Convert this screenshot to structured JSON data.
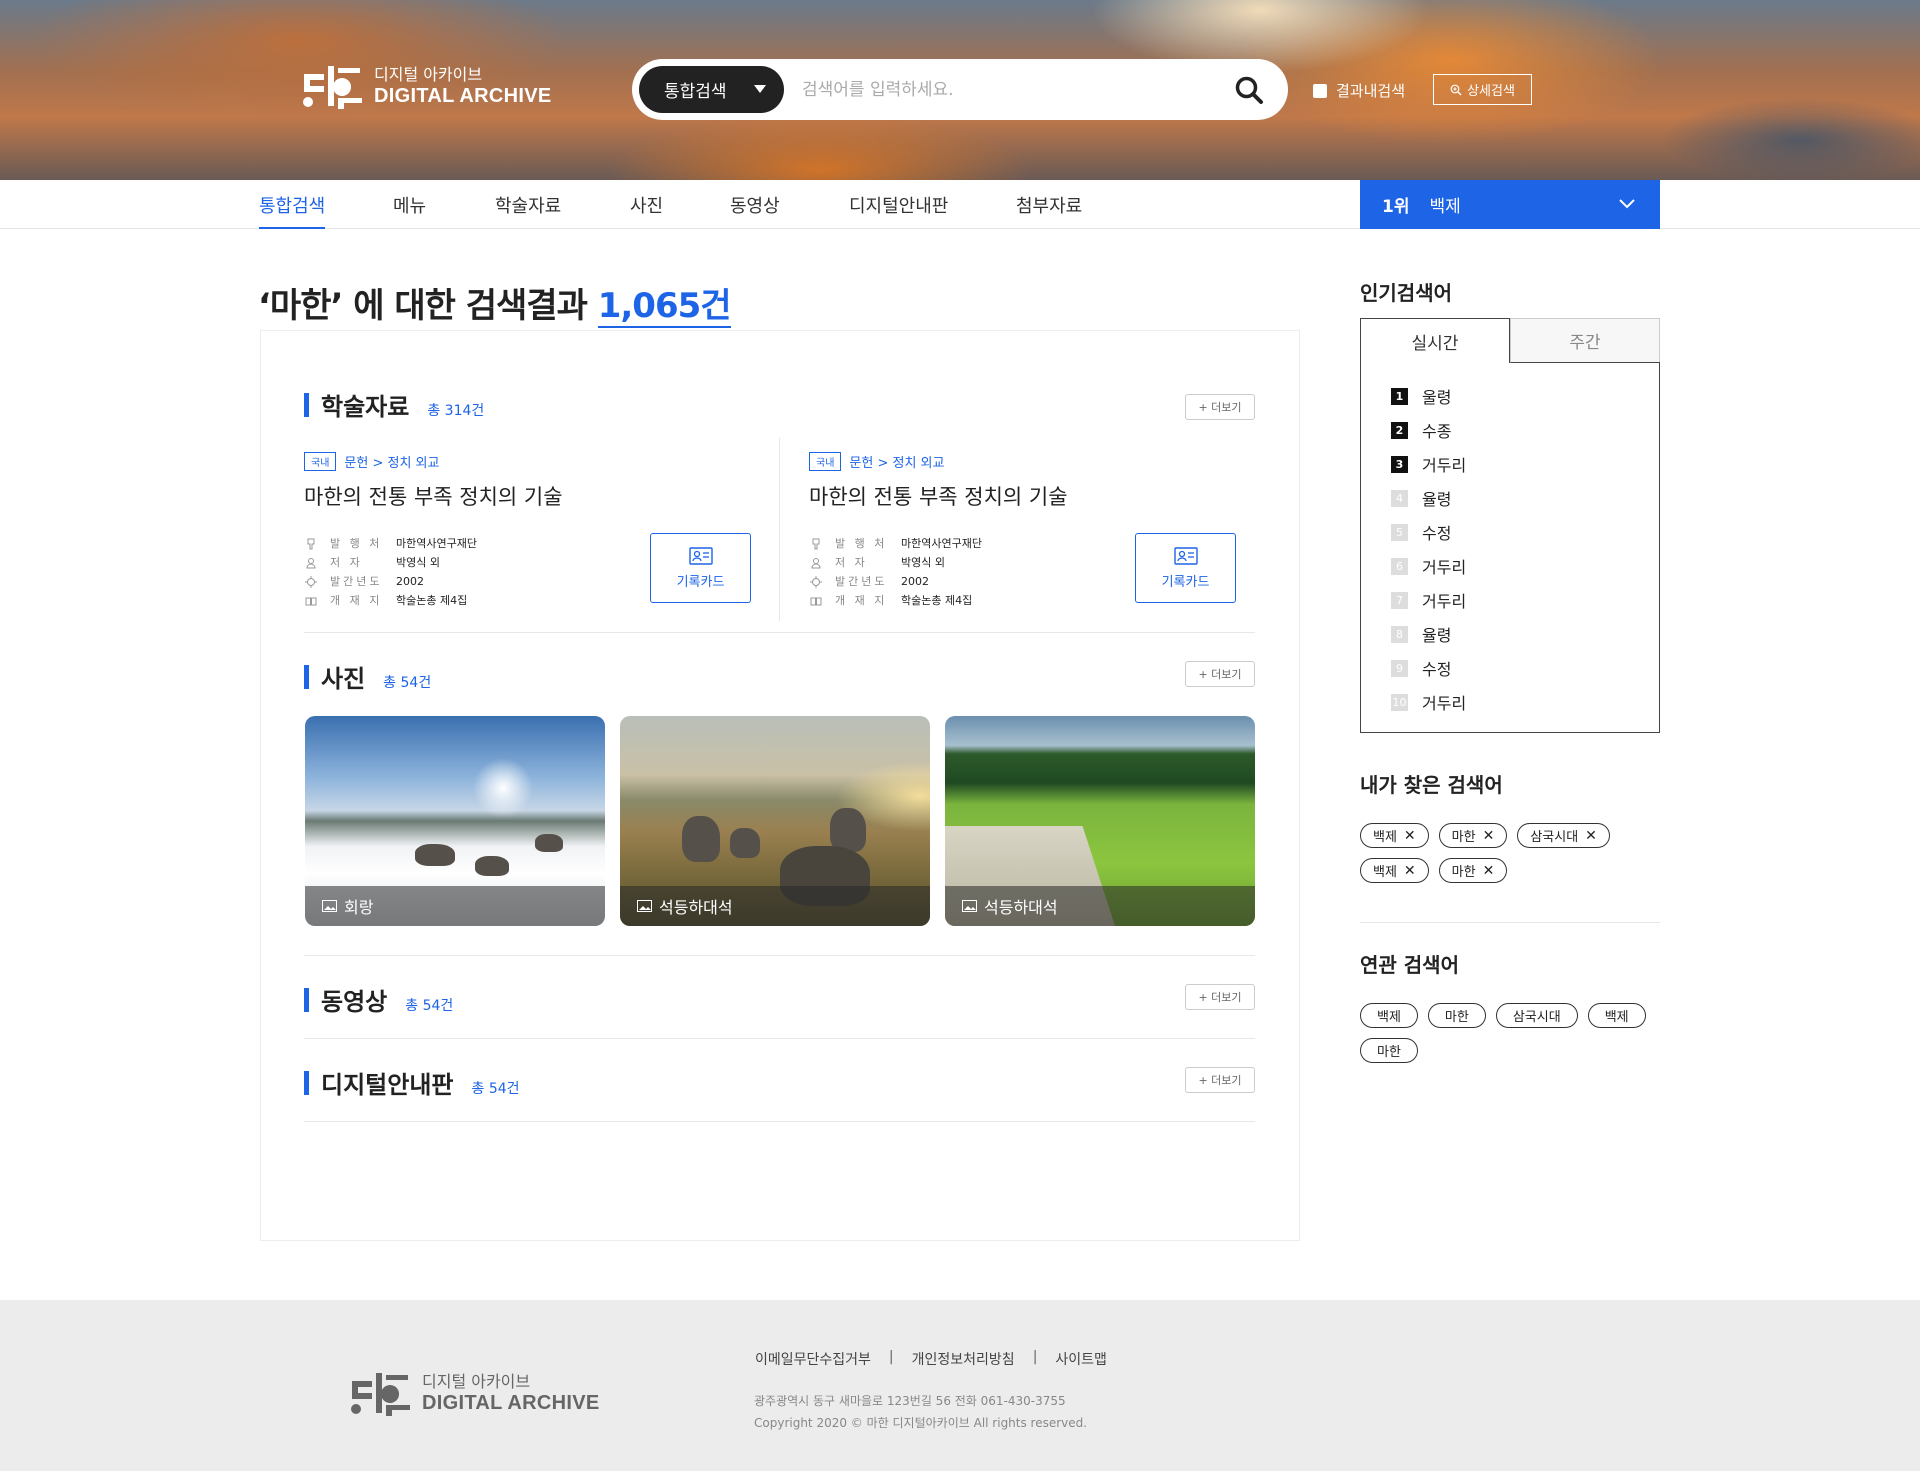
{
  "header": {
    "logo_ko": "디지털 아카이브",
    "logo_en": "DIGITAL ARCHIVE",
    "search_scope": "통합검색",
    "search_placeholder": "검색어를 입력하세요.",
    "in_result_label": "결과내검색",
    "advanced_label": "상세검색"
  },
  "nav": {
    "items": [
      "통합검색",
      "메뉴",
      "학술자료",
      "사진",
      "동영상",
      "디지털안내판",
      "첨부자료"
    ],
    "active_index": 0,
    "rank": {
      "num": "1위",
      "term": "백제"
    }
  },
  "results": {
    "title_prefix": "‘마한’ 에 대한 검색결과",
    "count": "1,065건"
  },
  "sections": {
    "papers": {
      "title": "학술자료",
      "count": "총 314건",
      "more": "+ 더보기",
      "items": [
        {
          "tag": "국내",
          "category": "문헌 > 정치 외교",
          "title": "마한의 전통 부족 정치의 기술",
          "publisher_key": "발 행 처",
          "publisher": "마한역사연구재단",
          "author_key": "저 자",
          "author": "박영식 외",
          "year_key": "발간년도",
          "year": "2002",
          "journal_key": "개 재 지",
          "journal": "학술논총 제4집",
          "card_label": "기록카드"
        },
        {
          "tag": "국내",
          "category": "문헌 > 정치 외교",
          "title": "마한의 전통 부족 정치의 기술",
          "publisher_key": "발 행 처",
          "publisher": "마한역사연구재단",
          "author_key": "저 자",
          "author": "박영식 외",
          "year_key": "발간년도",
          "year": "2002",
          "journal_key": "개 재 지",
          "journal": "학술논총 제4집",
          "card_label": "기록카드"
        }
      ]
    },
    "photos": {
      "title": "사진",
      "count": "총 54건",
      "more": "+ 더보기",
      "items": [
        {
          "caption": "회랑"
        },
        {
          "caption": "석등하대석"
        },
        {
          "caption": "석등하대석"
        }
      ]
    },
    "videos": {
      "title": "동영상",
      "count": "총 54건",
      "more": "+ 더보기"
    },
    "boards": {
      "title": "디지털안내판",
      "count": "총 54건",
      "more": "+ 더보기"
    }
  },
  "sidebar": {
    "popular_title": "인기검색어",
    "tab_realtime": "실시간",
    "tab_weekly": "주간",
    "popular": [
      {
        "rank": "1",
        "term": "울령"
      },
      {
        "rank": "2",
        "term": "수종"
      },
      {
        "rank": "3",
        "term": "거두리"
      },
      {
        "rank": "4",
        "term": "율령"
      },
      {
        "rank": "5",
        "term": "수정"
      },
      {
        "rank": "6",
        "term": "거두리"
      },
      {
        "rank": "7",
        "term": "거두리"
      },
      {
        "rank": "8",
        "term": "율령"
      },
      {
        "rank": "9",
        "term": "수정"
      },
      {
        "rank": "10",
        "term": "거두리"
      }
    ],
    "my_title": "내가 찾은 검색어",
    "my_terms": [
      "백제",
      "마한",
      "삼국시대",
      "백제",
      "마한"
    ],
    "related_title": "연관 검색어",
    "related_terms": [
      "백제",
      "마한",
      "삼국시대",
      "백제",
      "마한"
    ]
  },
  "footer": {
    "logo_ko": "디지털 아카이브",
    "logo_en": "DIGITAL ARCHIVE",
    "links": [
      "이메일무단수집거부",
      "개인정보처리방침",
      "사이트맵"
    ],
    "address": "광주광역시 동구 새마을로 123번길 56   전화  061-430-3755",
    "copyright": "Copyright 2020 © 마한 디지털아카이브  All rights reserved."
  },
  "colors": {
    "accent": "#1d64e6",
    "dark": "#222222"
  }
}
